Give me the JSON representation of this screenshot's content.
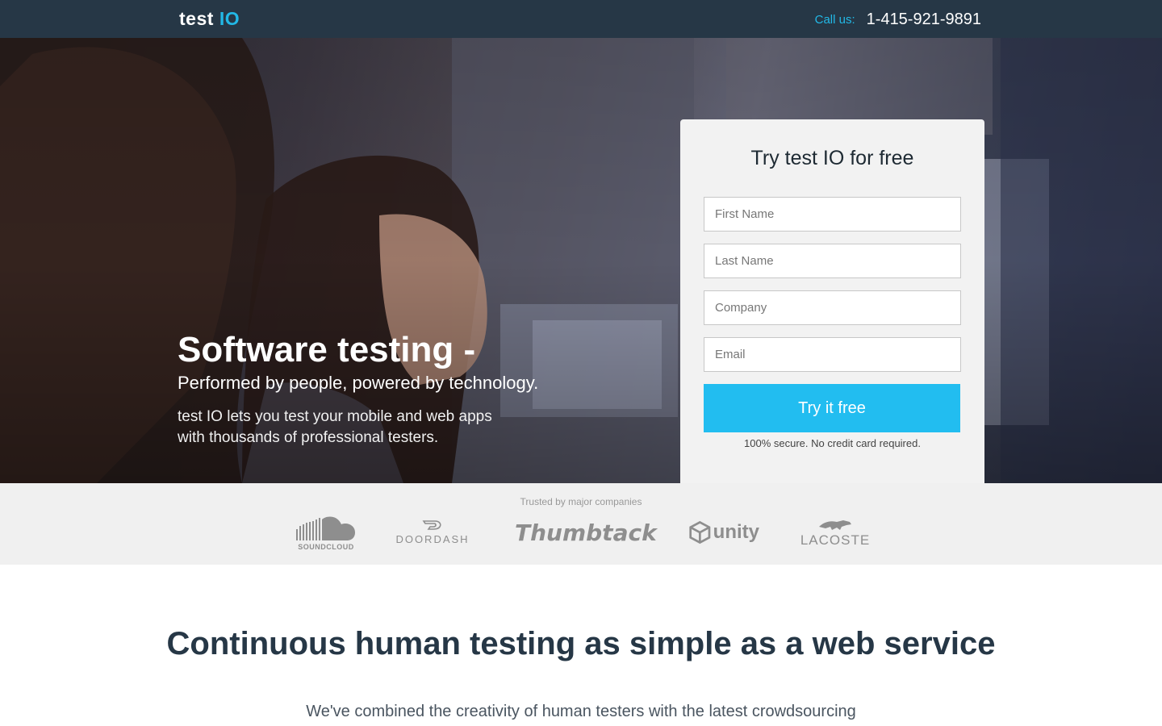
{
  "topbar": {
    "logo_part1": "test",
    "logo_part2": "IO",
    "call_label": "Call us:",
    "phone": "1-415-921-9891"
  },
  "hero": {
    "headline": "Software testing -",
    "subheadline": "Performed by people, powered by technology.",
    "description_line1": "test IO lets you test your mobile and web apps",
    "description_line2": "with thousands of professional testers."
  },
  "signup_form": {
    "title": "Try test IO for free",
    "first_name_placeholder": "First Name",
    "last_name_placeholder": "Last Name",
    "company_placeholder": "Company",
    "email_placeholder": "Email",
    "submit_label": "Try it free",
    "note": "100% secure. No credit card required."
  },
  "trusted": {
    "label": "Trusted by major companies",
    "companies": [
      "SOUNDCLOUD",
      "DOORDASH",
      "Thumbtack",
      "unity",
      "LACOSTE"
    ]
  },
  "section": {
    "title": "Continuous human testing as simple as a web service",
    "text": "We've combined the creativity of human testers with the latest crowdsourcing"
  },
  "colors": {
    "topbar_bg": "#263746",
    "accent": "#22b8e6",
    "button": "#22bdf0",
    "heading_dark": "#263746"
  }
}
